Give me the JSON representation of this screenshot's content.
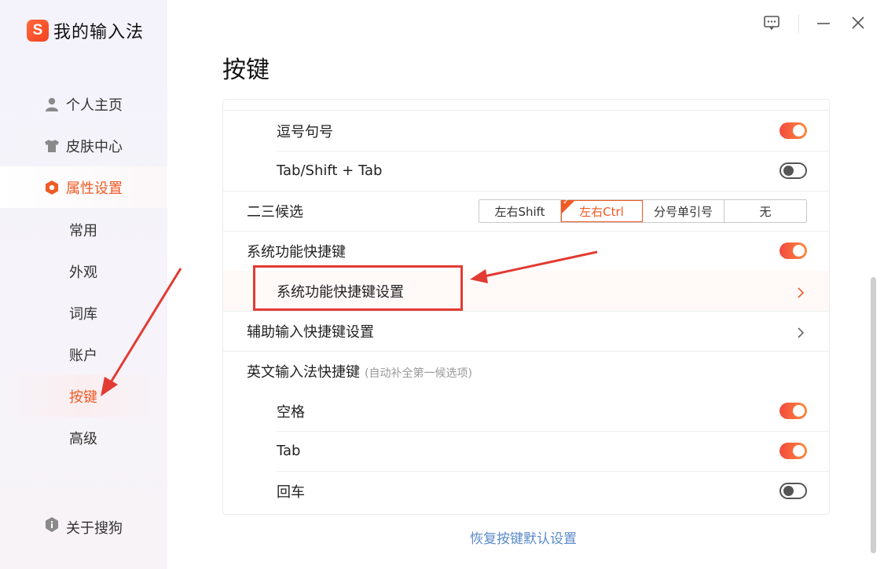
{
  "app": {
    "title": "我的输入法",
    "logo_letter": "S",
    "brand_color": "#f05a24"
  },
  "window": {
    "feedback_icon": "feedback-icon",
    "minimize_icon": "minimize-icon",
    "close_icon": "close-icon"
  },
  "sidebar": {
    "items": [
      {
        "label": "个人主页",
        "icon": "person-icon"
      },
      {
        "label": "皮肤中心",
        "icon": "shirt-icon"
      },
      {
        "label": "属性设置",
        "icon": "hexagon-settings-icon",
        "active": true
      }
    ],
    "sub_items": [
      {
        "label": "常用"
      },
      {
        "label": "外观"
      },
      {
        "label": "词库"
      },
      {
        "label": "账户"
      },
      {
        "label": "按键",
        "active": true
      },
      {
        "label": "高级"
      }
    ],
    "about": {
      "label": "关于搜狗",
      "icon": "info-shield-icon"
    }
  },
  "page": {
    "title": "按键",
    "rows": {
      "comma_period": {
        "label": "逗号句号",
        "enabled": true
      },
      "tab_shift_tab": {
        "label": "Tab/Shift + Tab",
        "enabled": false
      },
      "second_third_candidate": {
        "label": "二三候选",
        "options": [
          "左右Shift",
          "左右Ctrl",
          "分号单引号",
          "无"
        ],
        "selected": "左右Ctrl"
      },
      "system_shortcuts": {
        "label": "系统功能快捷键",
        "enabled": true
      },
      "system_shortcuts_settings": {
        "label": "系统功能快捷键设置"
      },
      "assist_input_shortcuts": {
        "label": "辅助输入快捷键设置"
      },
      "english_ime_shortcuts": {
        "label": "英文输入法快捷键",
        "hint": "(自动补全第一候选项)"
      },
      "space": {
        "label": "空格",
        "enabled": true
      },
      "tab": {
        "label": "Tab",
        "enabled": true
      },
      "enter": {
        "label": "回车",
        "enabled": false
      }
    },
    "restore_link": "恢复按键默认设置"
  },
  "colors": {
    "toggle_on_start": "#f24b3f",
    "toggle_on_end": "#ff8a3d",
    "annotation_red": "#e23b33",
    "link_blue": "#5b8bc9"
  }
}
